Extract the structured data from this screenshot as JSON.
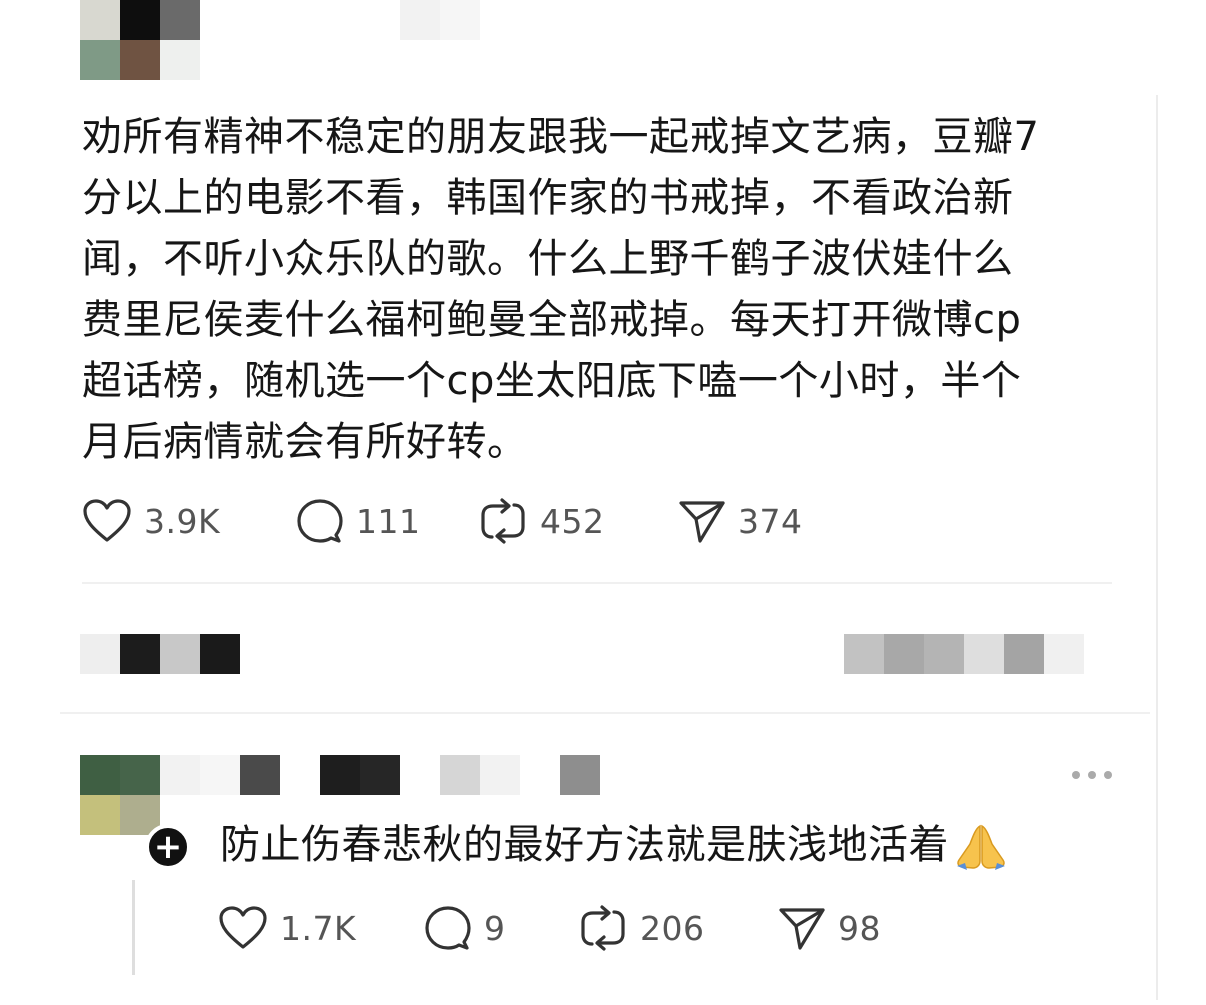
{
  "post": {
    "text": "劝所有精神不稳定的朋友跟我一起戒掉文艺病，豆瓣7\n分以上的电影不看，韩国作家的书戒掉，不看政治新\n闻，不听小众乐队的歌。什么上野千鹤子波伏娃什么\n费里尼侯麦什么福柯鲍曼全部戒掉。每天打开微博cp\n超话榜，随机选一个cp坐太阳底下嗑一个小时，半个\n月后病情就会有所好转。",
    "likes": "3.9K",
    "comments": "111",
    "reposts": "452",
    "shares": "374"
  },
  "reply": {
    "text": "防止伤春悲秋的最好方法就是肤浅地活着",
    "emoji_icon": "folded-hands-icon",
    "likes": "1.7K",
    "comments": "9",
    "reposts": "206",
    "shares": "98"
  },
  "icons": {
    "like": "heart-icon",
    "comment": "speech-bubble-icon",
    "repost": "repost-arrows-icon",
    "share": "paper-plane-icon",
    "more": "more-dots-icon",
    "follow": "plus-icon"
  },
  "colors": {
    "text": "#161616",
    "meta": "#555555",
    "icon": "#333333",
    "divider": "#f0f0f0"
  }
}
